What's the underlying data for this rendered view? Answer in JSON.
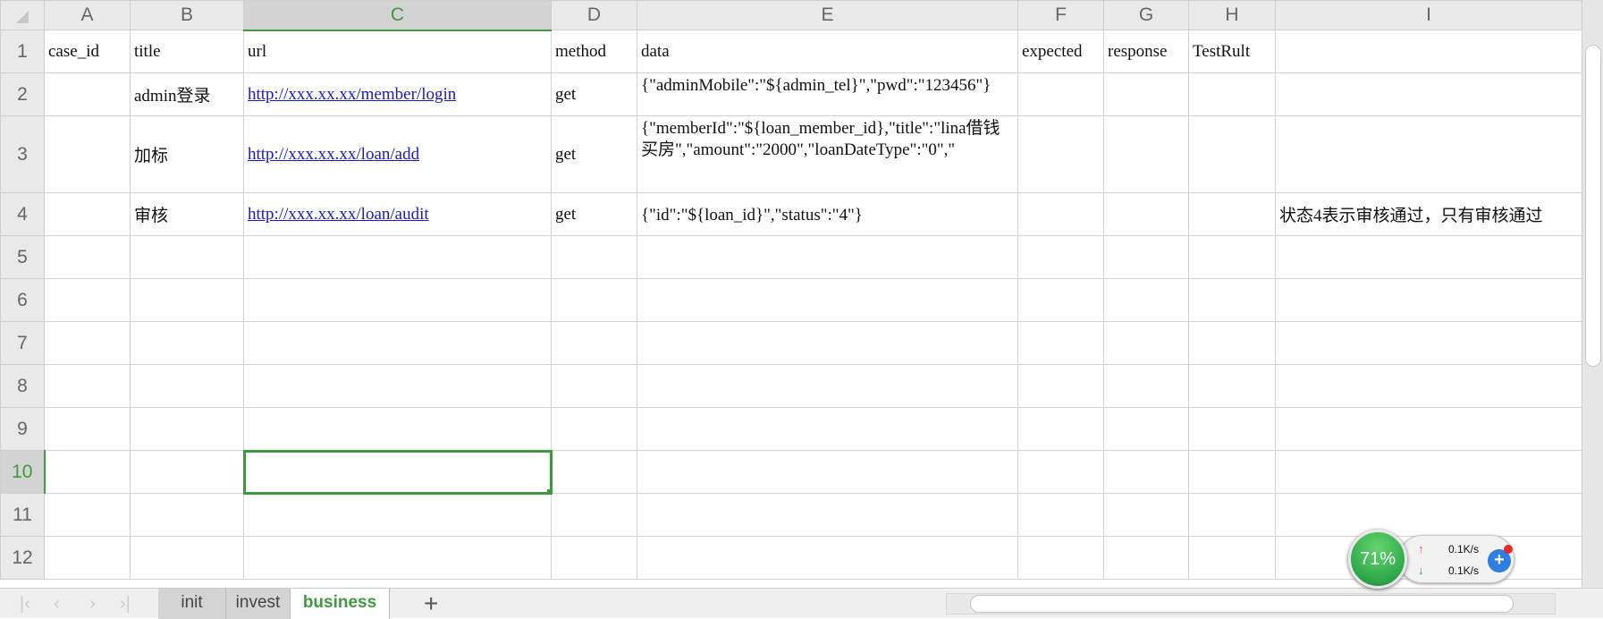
{
  "columns": [
    "A",
    "B",
    "C",
    "D",
    "E",
    "F",
    "G",
    "H",
    "I"
  ],
  "selected_column": "C",
  "selected_row": "10",
  "rows": [
    {
      "n": "1",
      "cells": [
        "case_id",
        "title",
        "url",
        "method",
        "data",
        "expected",
        "response",
        "TestRult",
        ""
      ]
    },
    {
      "n": "2",
      "cells": [
        "",
        "admin登录",
        "http://xxx.xx.xx/member/login",
        "get",
        "{\"adminMobile\":\"${admin_tel}\",\"pwd\":\"123456\"}",
        "",
        "",
        "",
        ""
      ]
    },
    {
      "n": "3",
      "cells": [
        "",
        "加标",
        "http://xxx.xx.xx/loan/add",
        "get",
        "{\"memberId\":\"${loan_member_id},\"title\":\"lina借钱买房\",\"amount\":\"2000\",\"loanDateType\":\"0\",\"",
        "",
        "",
        "",
        ""
      ]
    },
    {
      "n": "4",
      "cells": [
        "",
        "审核",
        "http://xxx.xx.xx/loan/audit",
        "get",
        "{\"id\":\"${loan_id}\",\"status\":\"4\"}",
        "",
        "",
        "",
        "状态4表示审核通过，只有审核通过"
      ]
    },
    {
      "n": "5"
    },
    {
      "n": "6"
    },
    {
      "n": "7"
    },
    {
      "n": "8"
    },
    {
      "n": "9"
    },
    {
      "n": "10"
    },
    {
      "n": "11"
    },
    {
      "n": "12"
    }
  ],
  "sheet_tabs": [
    {
      "label": "init"
    },
    {
      "label": "invest"
    },
    {
      "label": "business",
      "active": true
    }
  ],
  "add_sheet_label": "+",
  "net_widget": {
    "percent": "71%",
    "upload": "0.1K/s",
    "download": "0.1K/s"
  },
  "colors": {
    "accent": "#3f9a3f",
    "link": "#1a1acc"
  }
}
